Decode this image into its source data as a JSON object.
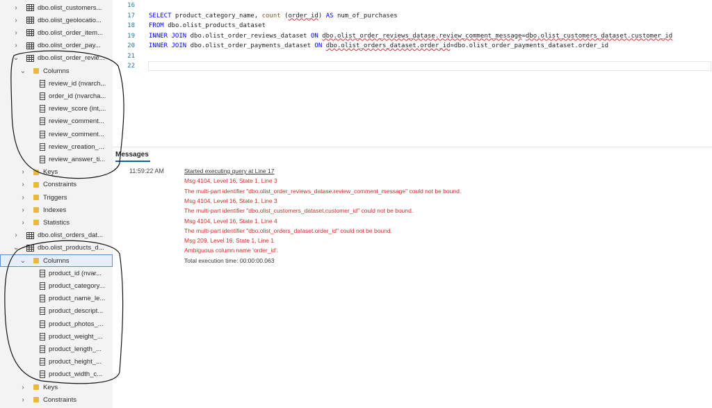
{
  "sidebar": {
    "items": [
      {
        "label": "dbo.olist_customers...",
        "type": "table",
        "chevron": "›"
      },
      {
        "label": "dbo.olist_geolocatio...",
        "type": "table",
        "chevron": "›"
      },
      {
        "label": "dbo.olist_order_item...",
        "type": "table",
        "chevron": "›"
      },
      {
        "label": "dbo.olist_order_pay...",
        "type": "table",
        "chevron": "›"
      },
      {
        "label": "dbo.olist_order_revie...",
        "type": "table",
        "chevron": "⌄"
      },
      {
        "label": "Columns",
        "type": "folder",
        "chevron": "⌄"
      },
      {
        "label": "review_id (nvarch...",
        "type": "column"
      },
      {
        "label": "order_id (nvarcha...",
        "type": "column"
      },
      {
        "label": "review_score (int,...",
        "type": "column"
      },
      {
        "label": "review_comment...",
        "type": "column"
      },
      {
        "label": "review_comment...",
        "type": "column"
      },
      {
        "label": "review_creation_...",
        "type": "column"
      },
      {
        "label": "review_answer_ti...",
        "type": "column"
      },
      {
        "label": "Keys",
        "type": "folder",
        "chevron": "›"
      },
      {
        "label": "Constraints",
        "type": "folder",
        "chevron": "›"
      },
      {
        "label": "Triggers",
        "type": "folder",
        "chevron": "›"
      },
      {
        "label": "Indexes",
        "type": "folder",
        "chevron": "›"
      },
      {
        "label": "Statistics",
        "type": "folder",
        "chevron": "›"
      },
      {
        "label": "dbo.olist_orders_dat...",
        "type": "table",
        "chevron": "›"
      },
      {
        "label": "dbo.olist_products_d...",
        "type": "table",
        "chevron": "⌄"
      },
      {
        "label": "Columns",
        "type": "folder",
        "chevron": "⌄",
        "selected": true
      },
      {
        "label": "product_id (nvar...",
        "type": "column"
      },
      {
        "label": "product_category...",
        "type": "column"
      },
      {
        "label": "product_name_le...",
        "type": "column"
      },
      {
        "label": "product_descript...",
        "type": "column"
      },
      {
        "label": "product_photos_...",
        "type": "column"
      },
      {
        "label": "product_weight_...",
        "type": "column"
      },
      {
        "label": "product_length_...",
        "type": "column"
      },
      {
        "label": "product_height_...",
        "type": "column"
      },
      {
        "label": "product_width_c...",
        "type": "column"
      },
      {
        "label": "Keys",
        "type": "folder",
        "chevron": "›"
      },
      {
        "label": "Constraints",
        "type": "folder",
        "chevron": "›"
      }
    ]
  },
  "editor": {
    "lines": [
      {
        "num": "16",
        "code": ""
      },
      {
        "num": "17",
        "code": "SELECT product_category_name, count (order_id) AS num_of_purchases"
      },
      {
        "num": "18",
        "code": "FROM dbo.olist_products_dataset"
      },
      {
        "num": "19",
        "code": "INNER JOIN dbo.olist_order_reviews_dataset ON dbo.olist_order_reviews_datase.review_comment_message=dbo.olist_customers_dataset.customer_id"
      },
      {
        "num": "20",
        "code": "INNER JOIN dbo.olist_order_payments_dataset ON dbo.olist_orders_dataset.order_id=dbo.olist_order_payments_dataset.order_id"
      },
      {
        "num": "21",
        "code": ""
      },
      {
        "num": "22",
        "code": ""
      }
    ]
  },
  "messages": {
    "tab_label": "Messages",
    "time": "11:59:22 AM",
    "entries": [
      {
        "text": "Started executing query at Line 17",
        "kind": "link"
      },
      {
        "text": "Msg 4104, Level 16, State 1, Line 3",
        "kind": "err"
      },
      {
        "text": "The multi-part identifier \"dbo.olist_order_reviews_datase.review_comment_message\" could not be bound.",
        "kind": "err"
      },
      {
        "text": "Msg 4104, Level 16, State 1, Line 3",
        "kind": "err"
      },
      {
        "text": "The multi-part identifier \"dbo.olist_customers_dataset.customer_id\" could not be bound.",
        "kind": "err"
      },
      {
        "text": "Msg 4104, Level 16, State 1, Line 4",
        "kind": "err"
      },
      {
        "text": "The multi-part identifier \"dbo.olist_orders_dataset.order_id\" could not be bound.",
        "kind": "err"
      },
      {
        "text": "Msg 209, Level 16, State 1, Line 1",
        "kind": "err"
      },
      {
        "text": "Ambiguous column name 'order_id'.",
        "kind": "err"
      },
      {
        "text": "Total execution time: 00:00:00.063",
        "kind": "plain"
      }
    ]
  },
  "colors": {
    "error": "#d42b2b",
    "keyword": "#0000ff",
    "line_number": "#237893",
    "accent": "#0e639c"
  }
}
